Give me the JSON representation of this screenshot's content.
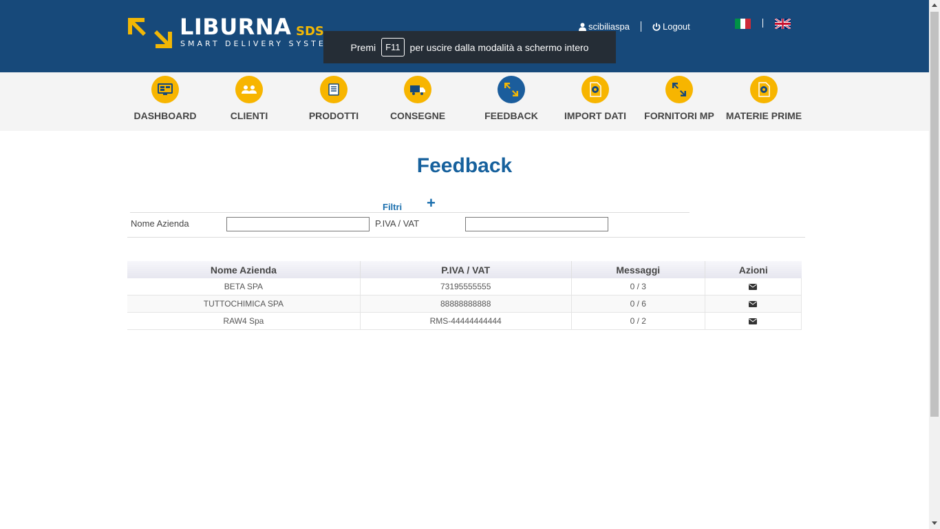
{
  "brand": {
    "name": "LIBURNA",
    "suffix": "SDS",
    "tagline": "SMART DELIVERY SYSTEM",
    "colors": {
      "header": "#17497a",
      "accent": "#f2b705",
      "title": "#17619d"
    }
  },
  "header": {
    "username": "scibiliaspa",
    "user_icon": "user-icon",
    "logout_label": "Logout",
    "logout_icon": "power-icon",
    "languages": [
      "it",
      "en"
    ]
  },
  "toast": {
    "before": "Premi",
    "key": "F11",
    "after": "per uscire dalla modalità a schermo intero"
  },
  "nav": {
    "items": [
      {
        "label": "DASHBOARD",
        "icon": "monitor-icon"
      },
      {
        "label": "CLIENTI",
        "icon": "users-icon"
      },
      {
        "label": "PRODOTTI",
        "icon": "box-icon"
      },
      {
        "label": "CONSEGNE",
        "icon": "truck-icon"
      },
      {
        "label": "FEEDBACK",
        "icon": "feedback-arrows-icon",
        "active": true
      },
      {
        "label": "IMPORT DATI",
        "icon": "gear-doc-icon"
      },
      {
        "label": "FORNITORI MP",
        "icon": "arrows-icon"
      },
      {
        "label": "MATERIE PRIME",
        "icon": "gear-doc-icon"
      }
    ]
  },
  "page": {
    "title": "Feedback"
  },
  "filters": {
    "label": "Filtri",
    "toggle": "+",
    "company_label": "Nome Azienda",
    "company_value": "",
    "vat_label": "P.IVA / VAT",
    "vat_value": ""
  },
  "table": {
    "headers": [
      "Nome Azienda",
      "P.IVA / VAT",
      "Messaggi",
      "Azioni"
    ],
    "rows": [
      {
        "company": "BETA SPA",
        "vat": "73195555555",
        "messages": "0 / 3",
        "action_icon": "envelope-icon"
      },
      {
        "company": "TUTTOCHIMICA SPA",
        "vat": "88888888888",
        "messages": "0 / 6",
        "action_icon": "envelope-icon"
      },
      {
        "company": "RAW4 Spa",
        "vat": "RMS-44444444444",
        "messages": "0 / 2",
        "action_icon": "envelope-icon"
      }
    ]
  }
}
